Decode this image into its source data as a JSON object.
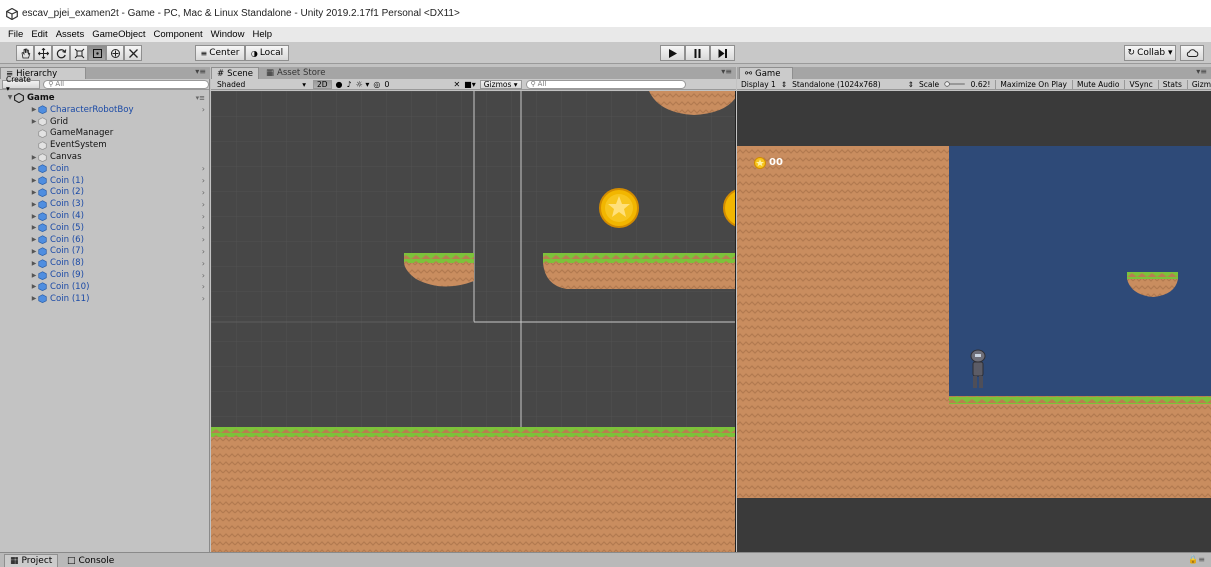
{
  "window": {
    "title": "escav_pjei_examen2t - Game - PC, Mac & Linux Standalone - Unity 2019.2.17f1 Personal <DX11>"
  },
  "menu": [
    "File",
    "Edit",
    "Assets",
    "GameObject",
    "Component",
    "Window",
    "Help"
  ],
  "toolbar": {
    "pivot_label": "Center",
    "space_label": "Local",
    "collab_label": "Collab ▾"
  },
  "hierarchy": {
    "tab_label": "Hierarchy",
    "create_label": "Create ▾",
    "search_placeholder": "All",
    "scene_name": "Game",
    "items": [
      {
        "label": "CharacterRobotBoy",
        "kind": "prefab",
        "expandable": true,
        "arrow": true
      },
      {
        "label": "Grid",
        "kind": "object",
        "expandable": true,
        "arrow": false
      },
      {
        "label": "GameManager",
        "kind": "object",
        "expandable": false,
        "arrow": false
      },
      {
        "label": "EventSystem",
        "kind": "object",
        "expandable": false,
        "arrow": false
      },
      {
        "label": "Canvas",
        "kind": "object",
        "expandable": true,
        "arrow": false
      },
      {
        "label": "Coin",
        "kind": "prefab",
        "expandable": true,
        "arrow": true
      },
      {
        "label": "Coin (1)",
        "kind": "prefab",
        "expandable": true,
        "arrow": true
      },
      {
        "label": "Coin (2)",
        "kind": "prefab",
        "expandable": true,
        "arrow": true
      },
      {
        "label": "Coin (3)",
        "kind": "prefab",
        "expandable": true,
        "arrow": true
      },
      {
        "label": "Coin (4)",
        "kind": "prefab",
        "expandable": true,
        "arrow": true
      },
      {
        "label": "Coin (5)",
        "kind": "prefab",
        "expandable": true,
        "arrow": true
      },
      {
        "label": "Coin (6)",
        "kind": "prefab",
        "expandable": true,
        "arrow": true
      },
      {
        "label": "Coin (7)",
        "kind": "prefab",
        "expandable": true,
        "arrow": true
      },
      {
        "label": "Coin (8)",
        "kind": "prefab",
        "expandable": true,
        "arrow": true
      },
      {
        "label": "Coin (9)",
        "kind": "prefab",
        "expandable": true,
        "arrow": true
      },
      {
        "label": "Coin (10)",
        "kind": "prefab",
        "expandable": true,
        "arrow": true
      },
      {
        "label": "Coin (11)",
        "kind": "prefab",
        "expandable": true,
        "arrow": true
      }
    ]
  },
  "scene": {
    "tab_label": "Scene",
    "asset_store_label": "Asset Store",
    "draw_mode": "Shaded",
    "mode_2d": "2D",
    "effects_count": "0",
    "gizmos_label": "Gizmos",
    "search_placeholder": "All"
  },
  "game": {
    "tab_label": "Game",
    "display": "Display 1",
    "resolution": "Standalone (1024x768)",
    "scale_label": "Scale",
    "scale_value": "0.62!",
    "maximize_on_play": "Maximize On Play",
    "mute_audio": "Mute Audio",
    "vsync": "VSync",
    "stats": "Stats",
    "gizmos": "Gizm",
    "coin_count": "00"
  },
  "bottom": {
    "project_label": "Project",
    "console_label": "Console"
  },
  "colors": {
    "dirt": "#c78b5e",
    "grass": "#7cc23a",
    "sky": "#2e4a78",
    "scene_bg": "#474747",
    "coin": "#f7c51e"
  }
}
